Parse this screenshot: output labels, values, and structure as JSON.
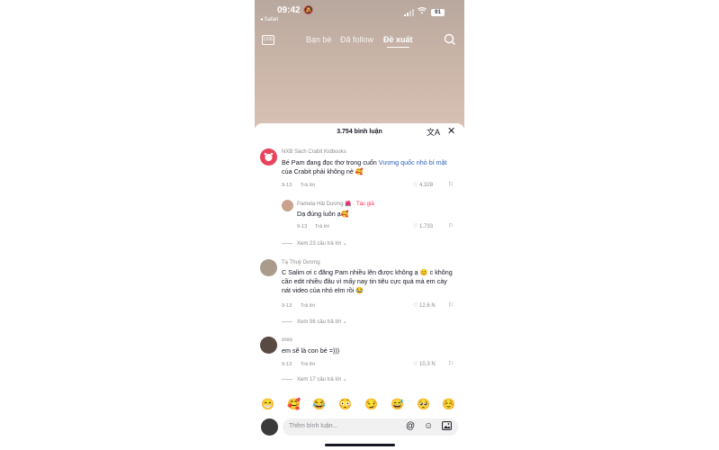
{
  "status": {
    "time": "09:42",
    "back_app": "◂ Safari",
    "battery": "91"
  },
  "nav": {
    "live_label": "LIVE",
    "tabs": [
      {
        "label": "Bạn bè",
        "active": false
      },
      {
        "label": "Đã follow",
        "active": false
      },
      {
        "label": "Đề xuất",
        "active": true
      }
    ]
  },
  "sheet": {
    "title": "3.754 bình luận",
    "comments": [
      {
        "user": "NXB Sách Crabit Kidbooks",
        "text_pre": "Bé Pam đang đọc thơ trong cuốn ",
        "text_link": "Vương quốc nhỏ bí mật",
        "text_post": " của Crabit phải không nè 🥰",
        "date": "9-13",
        "reply": "Trả lời",
        "likes": "4.328"
      },
      {
        "user": "Pamela Hải Dương 🌺",
        "author_tag": "· Tác giả",
        "text": "Dạ đúng luôn ạ🥰",
        "date": "9-13",
        "reply": "Trả lời",
        "likes": "1.733"
      },
      {
        "view_more": "Xem 23 câu trả lời ⌄"
      },
      {
        "user": "Tạ Thuỳ Dương",
        "text": "C Salim ơi c đăng Pam nhiều lên được không ạ 😊 c không cần edit nhiều đâu vì mấy nay tin tiêu cực quá mà em cày nát video của nhỏ elm rồi 😂",
        "date": "9-13",
        "reply": "Trả lời",
        "likes": "12,6 N"
      },
      {
        "view_more": "Xem 56 câu trả lời ⌄"
      },
      {
        "user": "oreo",
        "text": "em sẽ là con bé =)))",
        "date": "9-13",
        "reply": "Trả lời",
        "likes": "10,3 N"
      },
      {
        "view_more": "Xem 17 câu trả lời ⌄"
      }
    ]
  },
  "emojis": [
    "😁",
    "🥰",
    "😂",
    "😳",
    "😏",
    "😅",
    "🥺",
    "☺️"
  ],
  "input": {
    "placeholder": "Thêm bình luận..."
  }
}
